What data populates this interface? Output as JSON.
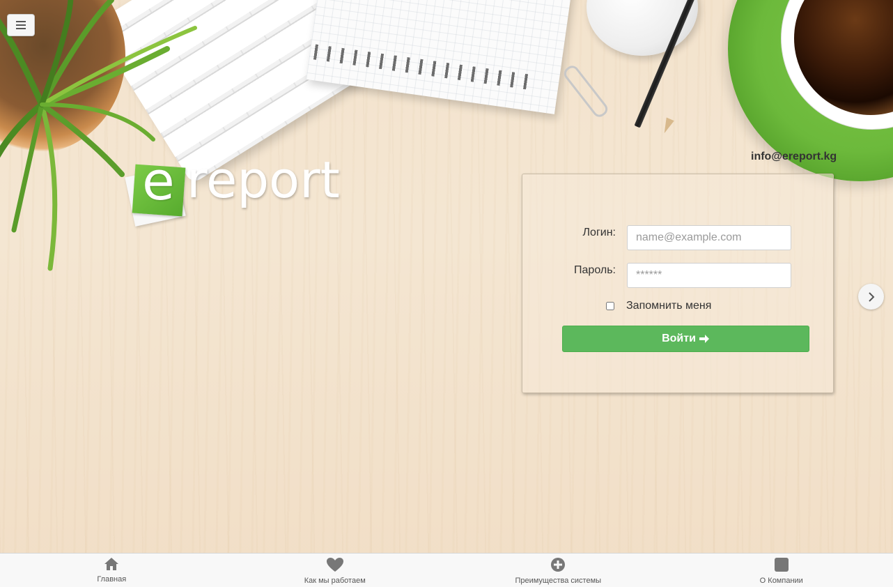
{
  "header": {
    "menu_icon": "hamburger-icon"
  },
  "logo": {
    "first_letter": "e",
    "rest": "report"
  },
  "contact": {
    "email": "info@ereport.kg"
  },
  "login_form": {
    "login_label": "Логин:",
    "login_placeholder": "name@example.com",
    "password_label": "Пароль:",
    "password_placeholder": "******",
    "remember_label": "Запомнить меня",
    "submit_label": "Войти",
    "submit_icon": "arrow-right-icon"
  },
  "carousel": {
    "next_icon": "chevron-right-icon"
  },
  "bottom_nav": {
    "items": [
      {
        "label": "Главная",
        "icon": "home-icon"
      },
      {
        "label": "Как мы работаем",
        "icon": "heart-icon"
      },
      {
        "label": "Преимущества системы",
        "icon": "plus-circle-icon"
      },
      {
        "label": "О Компании",
        "icon": "square-icon"
      }
    ]
  },
  "colors": {
    "primary_green": "#5cb85c",
    "brand_green": "#6cb93b",
    "nav_icon": "#777777"
  }
}
